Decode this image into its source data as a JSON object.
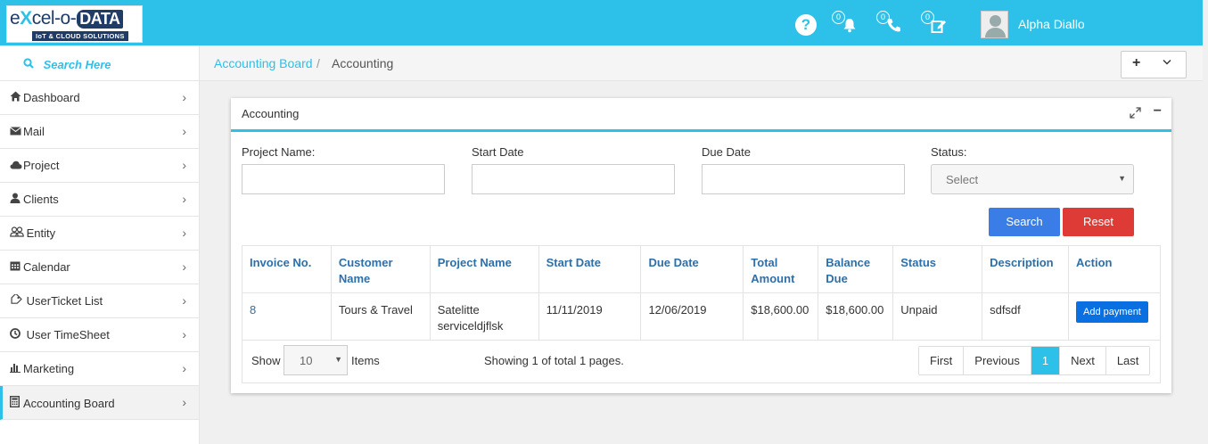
{
  "header": {
    "logo_main_prefix": "e",
    "logo_main_x": "X",
    "logo_main_mid": "cel-o-",
    "logo_main_data": "DATA",
    "logo_sub": "IoT & CLOUD SOLUTIONS",
    "help_glyph": "?",
    "notifications_count": "0",
    "calls_count": "0",
    "tasks_count": "0",
    "username": "Alpha Diallo",
    "accent": "#2dc0e8"
  },
  "sidebar": {
    "search_label": "Search Here",
    "items": [
      {
        "label": "Dashboard",
        "icon": "home-icon"
      },
      {
        "label": "Mail",
        "icon": "envelope-icon"
      },
      {
        "label": "Project",
        "icon": "cloud-icon"
      },
      {
        "label": "Clients",
        "icon": "user-icon"
      },
      {
        "label": "Entity",
        "icon": "users-icon"
      },
      {
        "label": "Calendar",
        "icon": "calendar-icon"
      },
      {
        "label": "UserTicket List",
        "icon": "tag-icon"
      },
      {
        "label": "User TimeSheet",
        "icon": "clock-icon"
      },
      {
        "label": "Marketing",
        "icon": "bar-chart-icon"
      },
      {
        "label": "Accounting Board",
        "icon": "calculator-icon"
      }
    ]
  },
  "breadcrumb": {
    "link": "Accounting Board",
    "separator": "/",
    "current": "Accounting"
  },
  "panel": {
    "title": "Accounting",
    "filters": {
      "project_name_label": "Project Name:",
      "start_date_label": "Start Date",
      "due_date_label": "Due Date",
      "status_label": "Status:",
      "status_value": "Select"
    },
    "search_label": "Search",
    "reset_label": "Reset",
    "columns": [
      "Invoice No.",
      "Customer Name",
      "Project Name",
      "Start Date",
      "Due Date",
      "Total Amount",
      "Balance Due",
      "Status",
      "Description",
      "Action"
    ],
    "rows": [
      {
        "invoice": "8",
        "customer": "Tours & Travel",
        "project": "Satelitte serviceldjflsk",
        "start": "11/11/2019",
        "due": "12/06/2019",
        "total": "$18,600.00",
        "balance": "$18,600.00",
        "status": "Unpaid",
        "description": "sdfsdf",
        "action": "Add payment"
      }
    ],
    "footer": {
      "show_label": "Show",
      "page_size": "10",
      "items_label": "Items",
      "page_info": "Showing 1 of total 1 pages.",
      "first": "First",
      "previous": "Previous",
      "current_page": "1",
      "next": "Next",
      "last": "Last"
    }
  }
}
